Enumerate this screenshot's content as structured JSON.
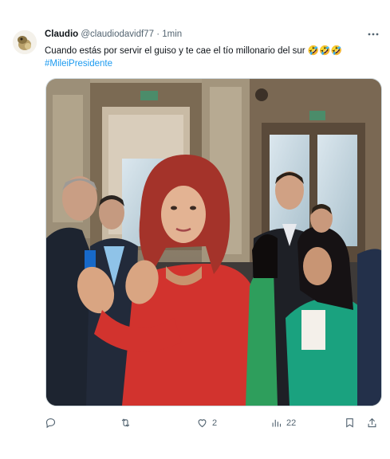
{
  "tweet": {
    "author_name": "Claudio",
    "author_handle": "@claudiodavidf77",
    "separator": "·",
    "time": "1min",
    "text": "Cuando estás por servir el guiso y te cae el tío millonario del sur 🤣🤣🤣",
    "hashtag": "#MileiPresidente",
    "media_alt": "photo"
  },
  "actions": {
    "reply_icon": "reply-icon",
    "retweet_icon": "retweet-icon",
    "like_icon": "heart-icon",
    "like_count": "2",
    "views_icon": "views-icon",
    "views_count": "22",
    "bookmark_icon": "bookmark-icon",
    "share_icon": "share-icon"
  },
  "colors": {
    "link": "#1d9bf0",
    "muted": "#536471",
    "text": "#0f1419",
    "dress_red": "#d2332e",
    "teal_dress": "#1aa27f"
  }
}
